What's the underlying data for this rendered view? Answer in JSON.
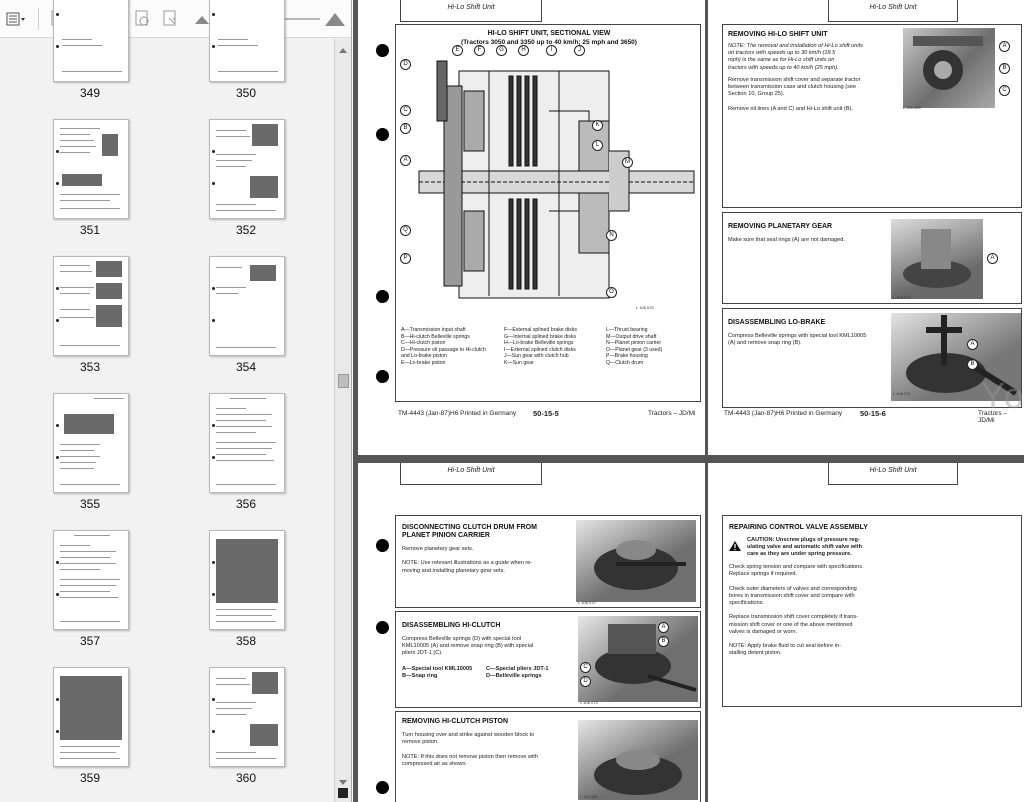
{
  "thumbnails": [
    {
      "number": "349",
      "variant": "blank-top"
    },
    {
      "number": "350",
      "variant": "blank-top"
    },
    {
      "number": "351",
      "variant": "text-photo"
    },
    {
      "number": "352",
      "variant": "photo-right"
    },
    {
      "number": "353",
      "variant": "three-photo"
    },
    {
      "number": "354",
      "variant": "sparse-photo"
    },
    {
      "number": "355",
      "variant": "diagram-text"
    },
    {
      "number": "356",
      "variant": "text-list"
    },
    {
      "number": "357",
      "variant": "text-list"
    },
    {
      "number": "358",
      "variant": "schematic"
    },
    {
      "number": "359",
      "variant": "schematic"
    },
    {
      "number": "360",
      "variant": "photo-right"
    }
  ],
  "toolbar": {
    "icons": [
      "thumbnail-options-icon",
      "delete-page-icon",
      "rotate-page-icon",
      "extract-page-icon",
      "print-pages-icon",
      "page-properties-icon",
      "zoom-out-thumbs-icon",
      "zoom-in-thumbs-icon"
    ]
  },
  "watermark": "YouFixThis.com",
  "page_top_left": {
    "header": "Hi-Lo Shift Unit",
    "title_line1": "HI-LO SHIFT UNIT, SECTIONAL VIEW",
    "title_line2": "(Tractors 3050 and 3350 up to 40 km/h; 25 mph and 3650)",
    "legend_col1": "A—Transmission input shaft\nB—Hi-clutch Belleville springs\nC—Hi-clutch piston\nD—Pressure oil passage to Hi-clutch\n    and Lo-brake piston\nE—Lo-brake piston",
    "legend_col2": "F—External splined brake disks\nG—Internal splined brake disks\nH—Lo-brake Belleville springs\nI—External splined clutch disks\nJ—Sun gear with clutch hub\nK—Sun gear",
    "legend_col3": "L—Thrust bearing\nM—Output drive shaft\nN—Planet pinion carrier\nO—Planet gear (3 used)\nP—Brake housing\nQ—Clutch drum",
    "fig_ref": "L 108 075",
    "footer_left": "TM-4443 (Jan-87)H6 Printed in Germany",
    "footer_page": "50-15-5",
    "footer_right": "Tractors – JD/Mi",
    "labels": [
      "D",
      "E",
      "F",
      "G",
      "H",
      "I",
      "J",
      "C",
      "B",
      "A",
      "K",
      "L",
      "M",
      "Q",
      "P",
      "N",
      "O"
    ]
  },
  "page_top_right": {
    "header": "Hi-Lo Shift Unit",
    "s1_title": "REMOVING HI-LO SHIFT UNIT",
    "s1_note": "NOTE: The removal and installation of Hi-Lo shift units\non tractors with speeds up to 30 km/h (18.5\nmph) is the same as for Hi-Lo shift units on\ntractors with speeds up to 40 km/h (25 mph).",
    "s1_body": "Remove transmission shift cover and separate tractor\nbetween transmission case and clutch housing (see\nSection 10, Group 25).\n\nRemove oil lines (A and C) and Hi-Lo shift unit (B).",
    "s1_fig": "L 108 069",
    "s2_title": "REMOVING PLANETARY GEAR",
    "s2_body": "Make sure that seal rings (A) are not damaged.",
    "s2_fig": "L 108 070",
    "s3_title": "DISASSEMBLING LO-BRAKE",
    "s3_body": "Compress Belleville springs with special tool KML10005\n(A) and remove snap ring (B).",
    "s3_fig": "L 108 071",
    "footer_left": "TM-4443 (Jan-87)H6 Printed in Germany",
    "footer_page": "50-15-6",
    "footer_right": "Tractors – JD/Mi"
  },
  "page_bottom_left": {
    "header": "Hi-Lo Shift Unit",
    "s1_title": "DISCONNECTING CLUTCH DRUM FROM\nPLANET PINION CARRIER",
    "s1_body": "Remove planetary gear sets.\n\nNOTE: Use relevant illustrations as a guide when re-\nmoving and installing planetary gear sets.",
    "s1_fig": "L 108 072",
    "s2_title": "DISASSEMBLING HI-CLUTCH",
    "s2_body": "Compress Belleville springs (D) with special tool\nKML10005 (A) and remove snap ring (B) with special\npliers JDT-1 (C).",
    "s2_legend1": "A—Special tool KML10005\nB—Snap ring",
    "s2_legend2": "C—Special pliers JDT-1\nD—Belleville springs",
    "s2_fig": "L 108 073",
    "s3_title": "REMOVING HI-CLUTCH PISTON",
    "s3_body": "Turn housing over and strike against wooden block to\nremove piston.\n\nNOTE: If this does not remove piston then remove with\ncompressed air as shown.",
    "s3_fig": "L 110 380"
  },
  "page_bottom_right": {
    "header": "Hi-Lo Shift Unit",
    "s1_title": "REPAIRING CONTROL VALVE ASSEMBLY",
    "s1_caution": "CAUTION: Unscrew plugs of pressure reg-\nulating valve and automatic shift valve with\ncare as they are under spring pressure.",
    "s1_body": "Check spring tension and compare with specifications.\nReplace springs if required.\n\nCheck outer diameters of valves and corresponding\nbores in transmission shift cover and compare with\nspecifications.\n\nReplace transmission shift cover completely if trans-\nmission shift cover or one of the above mentioned\nvalves is damaged or worn.\n\nNOTE: Apply brake fluid to cut seal before in-\nstalling detent piston."
  }
}
